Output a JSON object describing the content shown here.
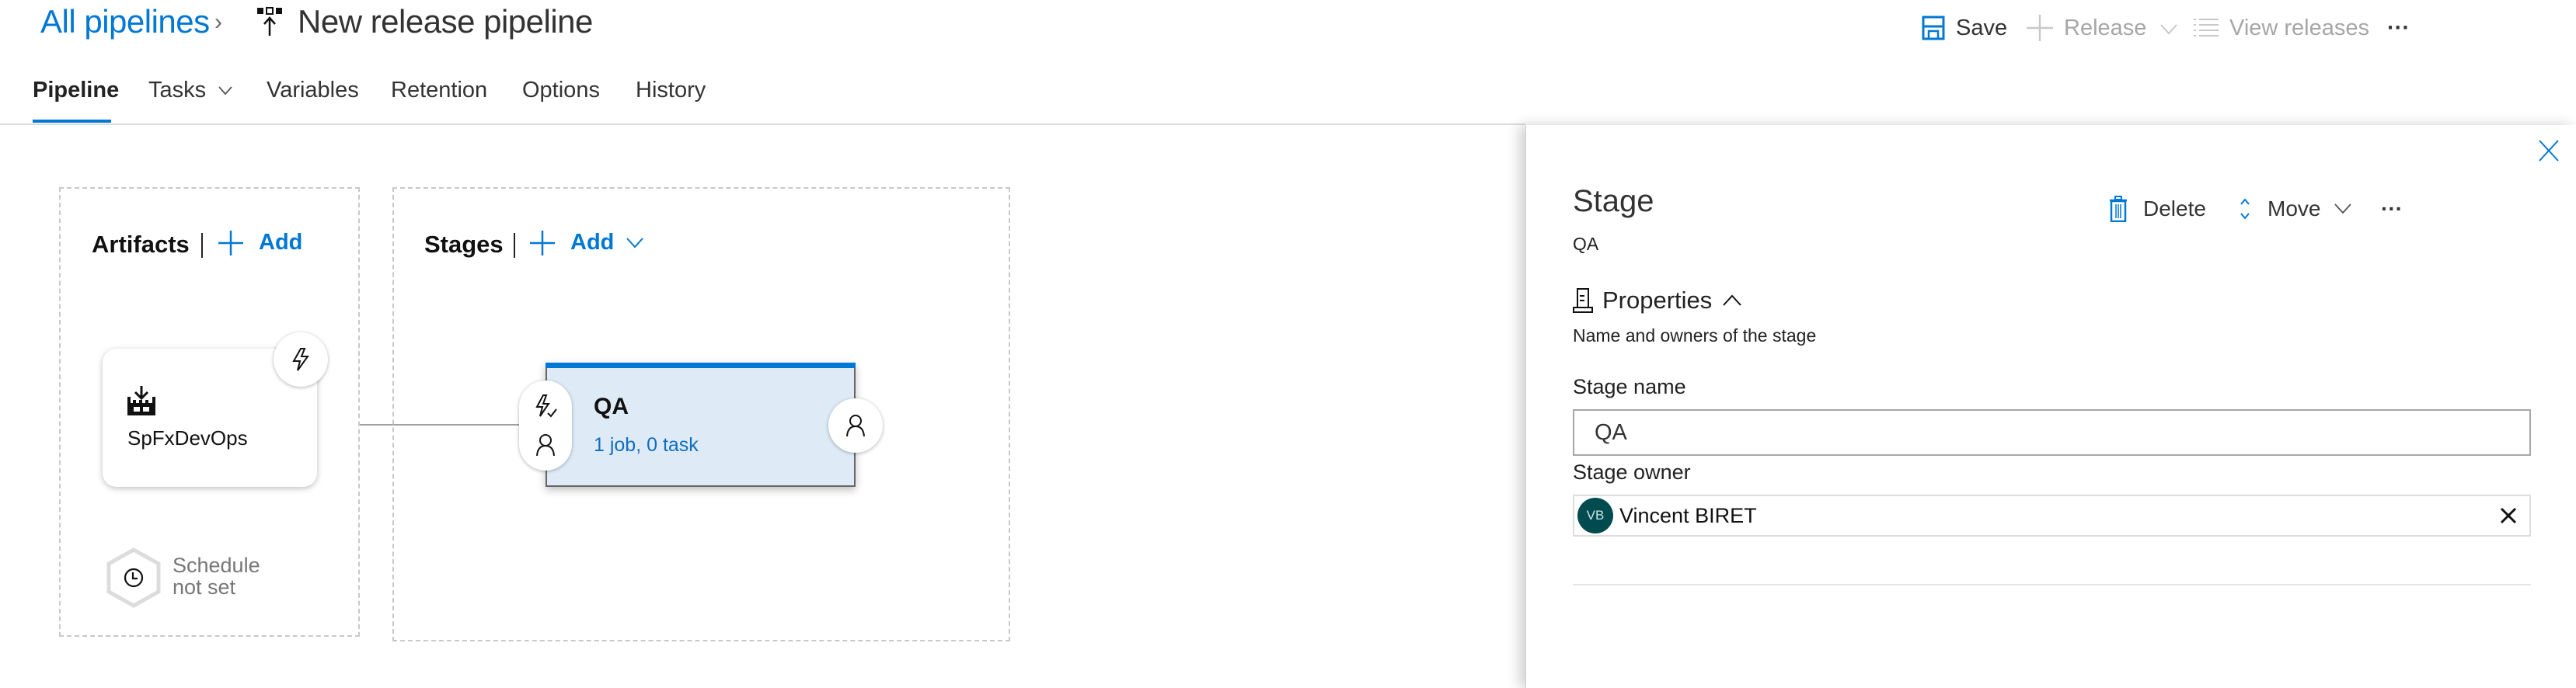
{
  "header": {
    "breadcrumb_root": "All pipelines",
    "breadcrumb_separator": "›",
    "pipeline_icon": "release-pipeline-icon",
    "title": "New release pipeline",
    "toolbar": {
      "save": {
        "label": "Save",
        "icon": "save-icon"
      },
      "release": {
        "label": "Release",
        "icon": "plus-icon",
        "disabled": true
      },
      "view_releases": {
        "label": "View releases",
        "icon": "list-icon",
        "disabled": true
      },
      "more": "···"
    }
  },
  "tabs": [
    {
      "label": "Pipeline",
      "active": true
    },
    {
      "label": "Tasks",
      "has_dropdown": true
    },
    {
      "label": "Variables"
    },
    {
      "label": "Retention"
    },
    {
      "label": "Options"
    },
    {
      "label": "History"
    }
  ],
  "artifacts": {
    "title": "Artifacts",
    "add_label": "Add",
    "items": [
      {
        "name": "SpFxDevOps",
        "icon": "build-artifact-icon",
        "trigger_icon": "lightning-icon"
      }
    ],
    "schedule": {
      "line1": "Schedule",
      "line2": "not set",
      "icon": "clock-icon"
    }
  },
  "stages": {
    "title": "Stages",
    "add_label": "Add",
    "items": [
      {
        "name": "QA",
        "summary": "1 job, 0 task"
      }
    ]
  },
  "panel": {
    "title": "Stage",
    "subtitle": "QA",
    "actions": {
      "delete": "Delete",
      "move": "Move",
      "more": "···"
    },
    "section": {
      "title": "Properties",
      "description": "Name and owners of the stage"
    },
    "fields": {
      "stage_name_label": "Stage name",
      "stage_name_value": "QA",
      "stage_owner_label": "Stage owner",
      "owner_initials": "VB",
      "owner_name": "Vincent BIRET"
    }
  },
  "colors": {
    "accent": "#0078d4",
    "stage_fill": "#deebf7",
    "avatar": "#004b50",
    "disabled_text": "#a6a6a6"
  }
}
